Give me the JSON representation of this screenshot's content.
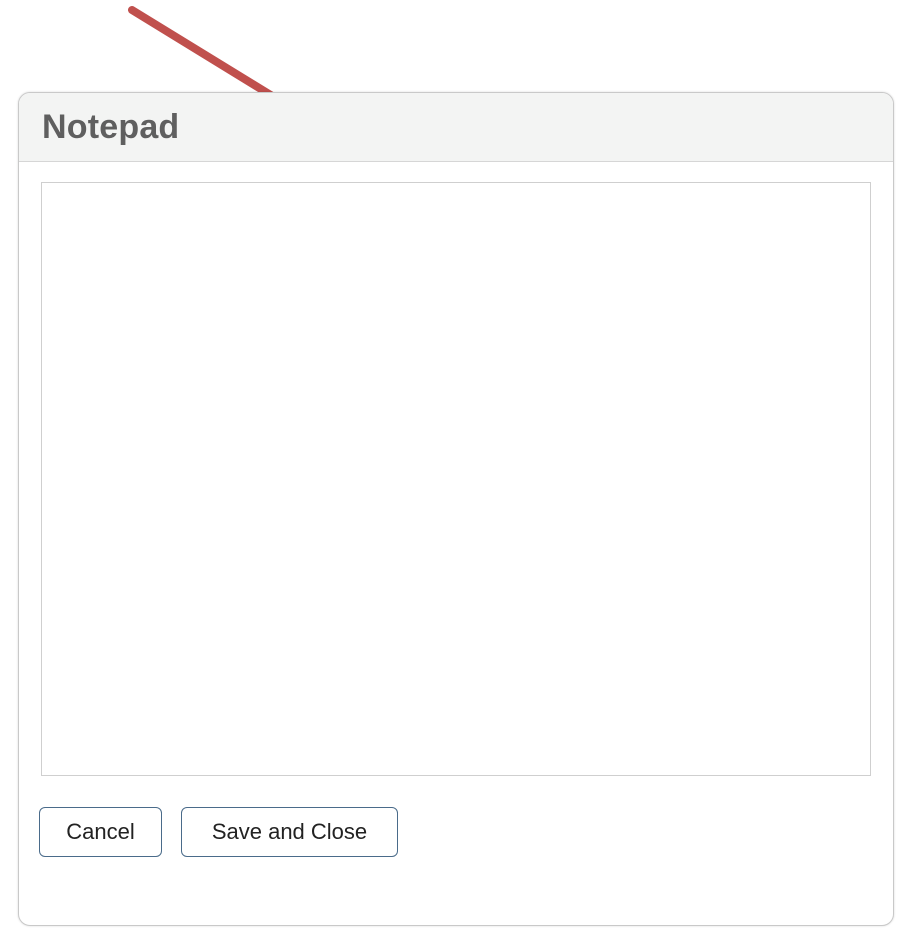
{
  "dialog": {
    "title": "Notepad",
    "notes": {
      "value": "",
      "placeholder": ""
    },
    "buttons": {
      "cancel_label": "Cancel",
      "save_label": "Save and Close"
    }
  },
  "annotation": {
    "arrow_color": "#c0504d",
    "icon": "arrow-pointer-icon"
  },
  "colors": {
    "title_text": "#5f5f5f",
    "header_bg": "#f3f4f3",
    "button_border": "#4a6b8a"
  }
}
